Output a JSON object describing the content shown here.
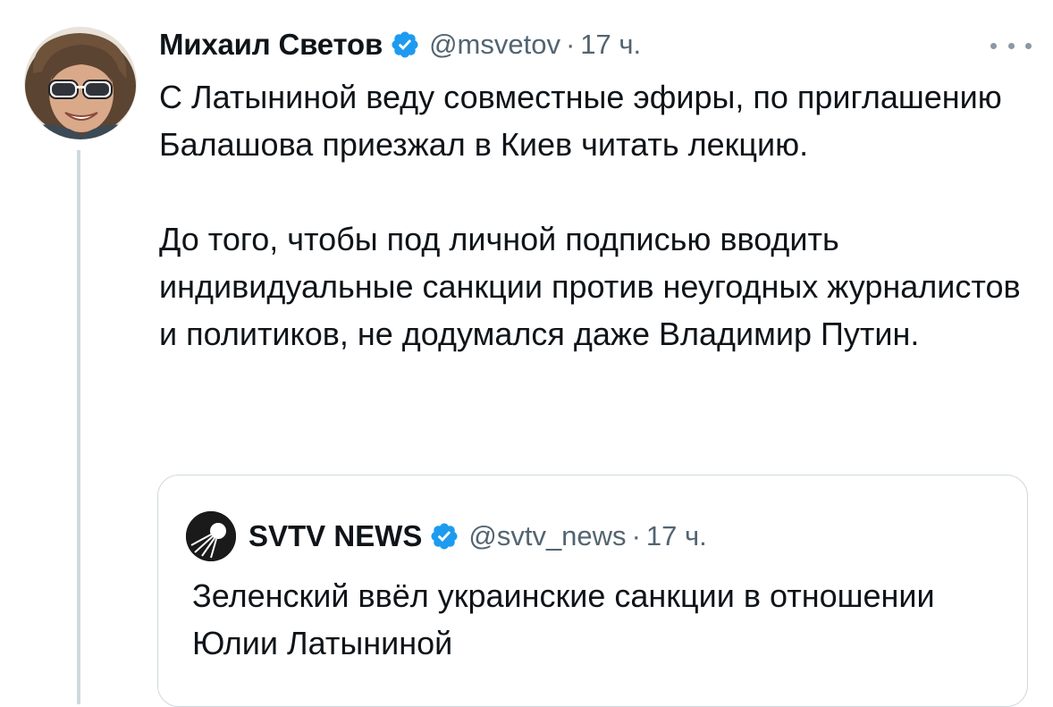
{
  "tweet": {
    "author": {
      "name": "Михаил Светов",
      "handle": "@msvetov",
      "separator": "·",
      "time": "17 ч.",
      "verified": true
    },
    "paragraphs": [
      "С Латыниной веду совместные эфиры, по приглашению Балашова приезжал в Киев читать лекцию.",
      "До того, чтобы под личной подписью вводить индивидуальные санкции против неугодных журналистов и политиков, не додумался даже Владимир Путин."
    ],
    "icons": {
      "verified": "verified-badge-icon",
      "more": "more-options-icon"
    }
  },
  "quote": {
    "author": {
      "name": "SVTV NEWS",
      "handle": "@svtv_news",
      "separator": "·",
      "time": "17 ч.",
      "verified": true
    },
    "text": "Зеленский ввёл украинские санкции в отношении Юлии Латыниной"
  },
  "colors": {
    "verified_blue": "#1d9bf0",
    "secondary_text": "#536471",
    "border": "#cfd9de",
    "thread_line": "#cfd9de"
  }
}
